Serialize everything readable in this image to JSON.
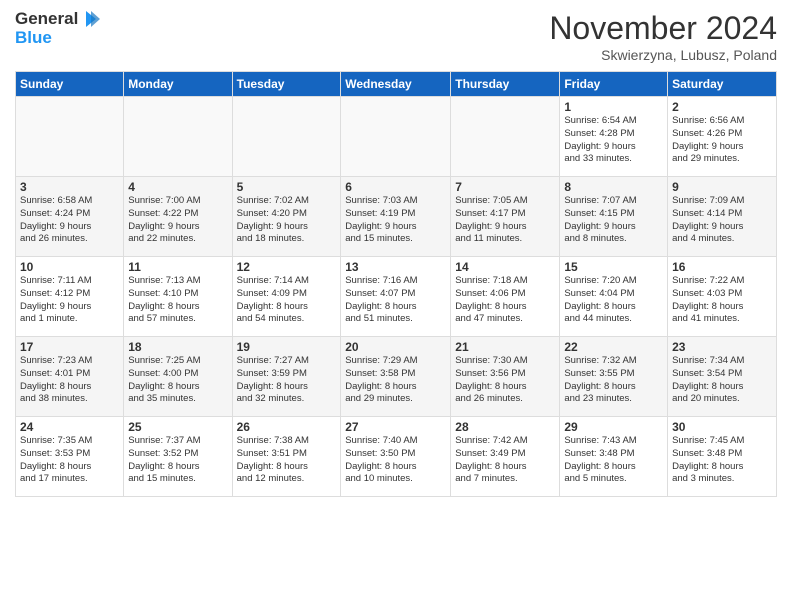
{
  "header": {
    "logo_line1": "General",
    "logo_line2": "Blue",
    "month": "November 2024",
    "location": "Skwierzyna, Lubusz, Poland"
  },
  "columns": [
    "Sunday",
    "Monday",
    "Tuesday",
    "Wednesday",
    "Thursday",
    "Friday",
    "Saturday"
  ],
  "weeks": [
    [
      {
        "day": "",
        "info": ""
      },
      {
        "day": "",
        "info": ""
      },
      {
        "day": "",
        "info": ""
      },
      {
        "day": "",
        "info": ""
      },
      {
        "day": "",
        "info": ""
      },
      {
        "day": "1",
        "info": "Sunrise: 6:54 AM\nSunset: 4:28 PM\nDaylight: 9 hours\nand 33 minutes."
      },
      {
        "day": "2",
        "info": "Sunrise: 6:56 AM\nSunset: 4:26 PM\nDaylight: 9 hours\nand 29 minutes."
      }
    ],
    [
      {
        "day": "3",
        "info": "Sunrise: 6:58 AM\nSunset: 4:24 PM\nDaylight: 9 hours\nand 26 minutes."
      },
      {
        "day": "4",
        "info": "Sunrise: 7:00 AM\nSunset: 4:22 PM\nDaylight: 9 hours\nand 22 minutes."
      },
      {
        "day": "5",
        "info": "Sunrise: 7:02 AM\nSunset: 4:20 PM\nDaylight: 9 hours\nand 18 minutes."
      },
      {
        "day": "6",
        "info": "Sunrise: 7:03 AM\nSunset: 4:19 PM\nDaylight: 9 hours\nand 15 minutes."
      },
      {
        "day": "7",
        "info": "Sunrise: 7:05 AM\nSunset: 4:17 PM\nDaylight: 9 hours\nand 11 minutes."
      },
      {
        "day": "8",
        "info": "Sunrise: 7:07 AM\nSunset: 4:15 PM\nDaylight: 9 hours\nand 8 minutes."
      },
      {
        "day": "9",
        "info": "Sunrise: 7:09 AM\nSunset: 4:14 PM\nDaylight: 9 hours\nand 4 minutes."
      }
    ],
    [
      {
        "day": "10",
        "info": "Sunrise: 7:11 AM\nSunset: 4:12 PM\nDaylight: 9 hours\nand 1 minute."
      },
      {
        "day": "11",
        "info": "Sunrise: 7:13 AM\nSunset: 4:10 PM\nDaylight: 8 hours\nand 57 minutes."
      },
      {
        "day": "12",
        "info": "Sunrise: 7:14 AM\nSunset: 4:09 PM\nDaylight: 8 hours\nand 54 minutes."
      },
      {
        "day": "13",
        "info": "Sunrise: 7:16 AM\nSunset: 4:07 PM\nDaylight: 8 hours\nand 51 minutes."
      },
      {
        "day": "14",
        "info": "Sunrise: 7:18 AM\nSunset: 4:06 PM\nDaylight: 8 hours\nand 47 minutes."
      },
      {
        "day": "15",
        "info": "Sunrise: 7:20 AM\nSunset: 4:04 PM\nDaylight: 8 hours\nand 44 minutes."
      },
      {
        "day": "16",
        "info": "Sunrise: 7:22 AM\nSunset: 4:03 PM\nDaylight: 8 hours\nand 41 minutes."
      }
    ],
    [
      {
        "day": "17",
        "info": "Sunrise: 7:23 AM\nSunset: 4:01 PM\nDaylight: 8 hours\nand 38 minutes."
      },
      {
        "day": "18",
        "info": "Sunrise: 7:25 AM\nSunset: 4:00 PM\nDaylight: 8 hours\nand 35 minutes."
      },
      {
        "day": "19",
        "info": "Sunrise: 7:27 AM\nSunset: 3:59 PM\nDaylight: 8 hours\nand 32 minutes."
      },
      {
        "day": "20",
        "info": "Sunrise: 7:29 AM\nSunset: 3:58 PM\nDaylight: 8 hours\nand 29 minutes."
      },
      {
        "day": "21",
        "info": "Sunrise: 7:30 AM\nSunset: 3:56 PM\nDaylight: 8 hours\nand 26 minutes."
      },
      {
        "day": "22",
        "info": "Sunrise: 7:32 AM\nSunset: 3:55 PM\nDaylight: 8 hours\nand 23 minutes."
      },
      {
        "day": "23",
        "info": "Sunrise: 7:34 AM\nSunset: 3:54 PM\nDaylight: 8 hours\nand 20 minutes."
      }
    ],
    [
      {
        "day": "24",
        "info": "Sunrise: 7:35 AM\nSunset: 3:53 PM\nDaylight: 8 hours\nand 17 minutes."
      },
      {
        "day": "25",
        "info": "Sunrise: 7:37 AM\nSunset: 3:52 PM\nDaylight: 8 hours\nand 15 minutes."
      },
      {
        "day": "26",
        "info": "Sunrise: 7:38 AM\nSunset: 3:51 PM\nDaylight: 8 hours\nand 12 minutes."
      },
      {
        "day": "27",
        "info": "Sunrise: 7:40 AM\nSunset: 3:50 PM\nDaylight: 8 hours\nand 10 minutes."
      },
      {
        "day": "28",
        "info": "Sunrise: 7:42 AM\nSunset: 3:49 PM\nDaylight: 8 hours\nand 7 minutes."
      },
      {
        "day": "29",
        "info": "Sunrise: 7:43 AM\nSunset: 3:48 PM\nDaylight: 8 hours\nand 5 minutes."
      },
      {
        "day": "30",
        "info": "Sunrise: 7:45 AM\nSunset: 3:48 PM\nDaylight: 8 hours\nand 3 minutes."
      }
    ]
  ]
}
